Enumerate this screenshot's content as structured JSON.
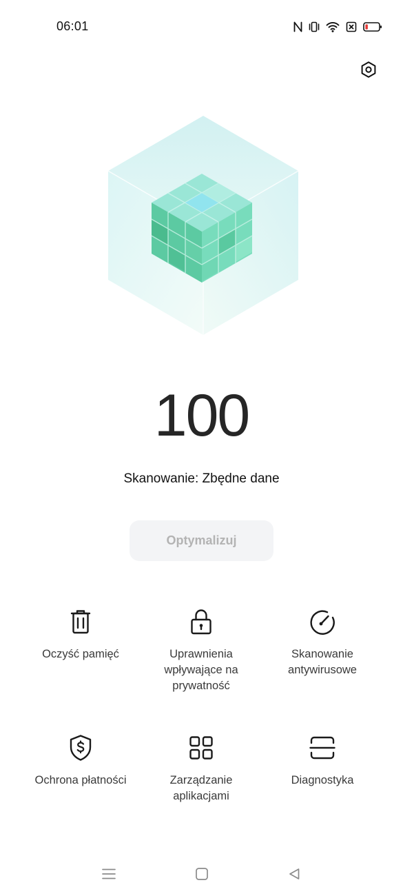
{
  "status_bar": {
    "time": "06:01",
    "icons": [
      "nfc-icon",
      "vibrate-icon",
      "wifi-icon",
      "sim-off-icon",
      "battery-low-icon"
    ],
    "battery_color": "#e53935"
  },
  "header": {
    "settings_icon": "gear-icon"
  },
  "hero": {
    "illustration": "cube-icon",
    "accent": "#5fd3a8"
  },
  "score": {
    "value": "100"
  },
  "scan": {
    "status_text": "Skanowanie: Zbędne dane"
  },
  "optimize": {
    "label": "Optymalizuj",
    "enabled": false
  },
  "tools": [
    {
      "label": "Oczyść pamięć",
      "icon": "trash-icon"
    },
    {
      "label": "Uprawnienia\nwpływające na\nprywatność",
      "icon": "lock-icon"
    },
    {
      "label": "Skanowanie\nantywirusowe",
      "icon": "gauge-icon"
    },
    {
      "label": "Ochrona płatności",
      "icon": "shield-dollar-icon"
    },
    {
      "label": "Zarządzanie\naplikacjami",
      "icon": "apps-grid-icon"
    },
    {
      "label": "Diagnostyka",
      "icon": "scan-frame-icon"
    }
  ],
  "nav": {
    "icons": [
      "menu-icon",
      "home-icon",
      "back-icon"
    ]
  }
}
